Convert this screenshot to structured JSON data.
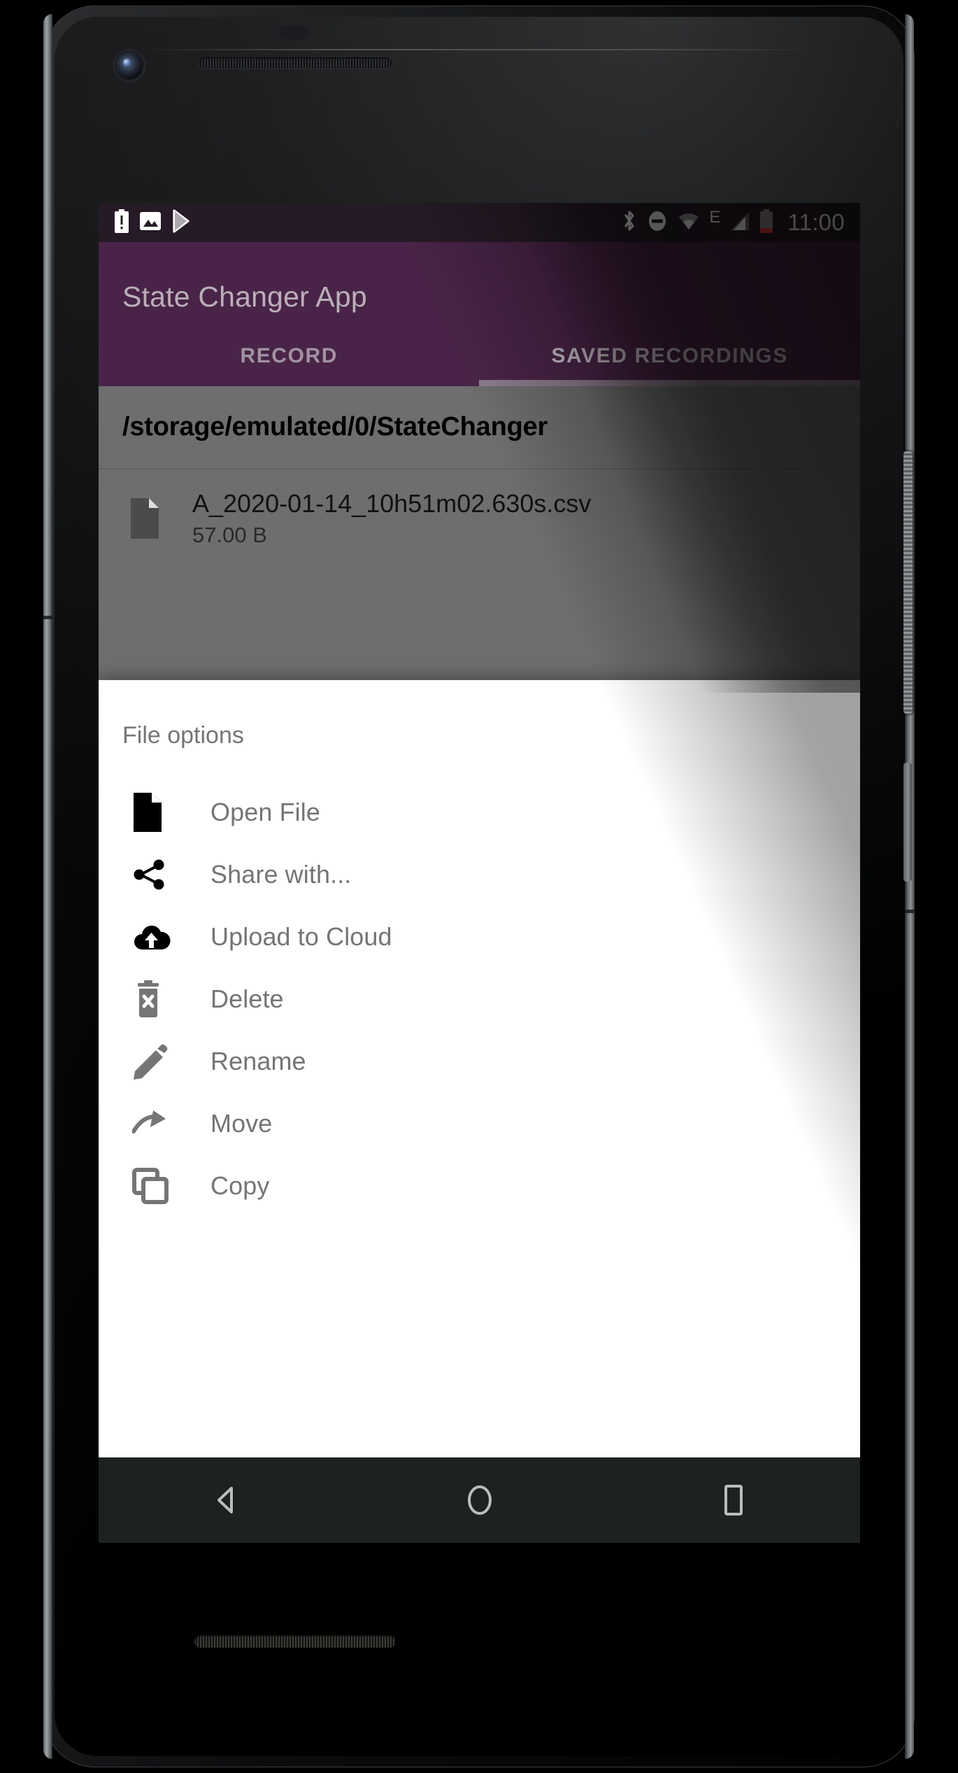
{
  "status_bar": {
    "time": "11:00",
    "left_icons": [
      "battery-alert-icon",
      "image-icon",
      "play-store-icon"
    ],
    "right_icons": [
      "bluetooth-icon",
      "do-not-disturb-icon",
      "wifi-icon",
      "edge-network-icon",
      "signal-icon",
      "battery-icon"
    ],
    "network_label": "E",
    "background_color": "#261a27"
  },
  "app_bar": {
    "title": "State Changer App",
    "background_color": "#4a2448",
    "title_color": "#b9b0b8"
  },
  "tabs": [
    {
      "label": "RECORD",
      "active": false
    },
    {
      "label": "SAVED RECORDINGS",
      "active": true
    }
  ],
  "content": {
    "path": "/storage/emulated/0/StateChanger",
    "files": [
      {
        "name": "A_2020-01-14_10h51m02.630s.csv",
        "size": "57.00 B",
        "icon": "file-icon"
      }
    ],
    "scrim_color": "#6e6e6e"
  },
  "sheet": {
    "title": "File options",
    "items": [
      {
        "label": "Open File",
        "icon": "file-document-icon",
        "icon_color": "#000000"
      },
      {
        "label": "Share with...",
        "icon": "share-icon",
        "icon_color": "#000000"
      },
      {
        "label": "Upload to Cloud",
        "icon": "cloud-upload-icon",
        "icon_color": "#000000"
      },
      {
        "label": "Delete",
        "icon": "delete-trash-icon",
        "icon_color": "#757575"
      },
      {
        "label": "Rename",
        "icon": "pencil-icon",
        "icon_color": "#757575"
      },
      {
        "label": "Move",
        "icon": "move-arrow-icon",
        "icon_color": "#757575"
      },
      {
        "label": "Copy",
        "icon": "copy-icon",
        "icon_color": "#757575"
      }
    ],
    "background_color": "#ffffff",
    "label_color": "#757575"
  },
  "nav_bar": {
    "back_label": "Back",
    "home_label": "Home",
    "recents_label": "Recents",
    "background_color": "#1e2122"
  }
}
